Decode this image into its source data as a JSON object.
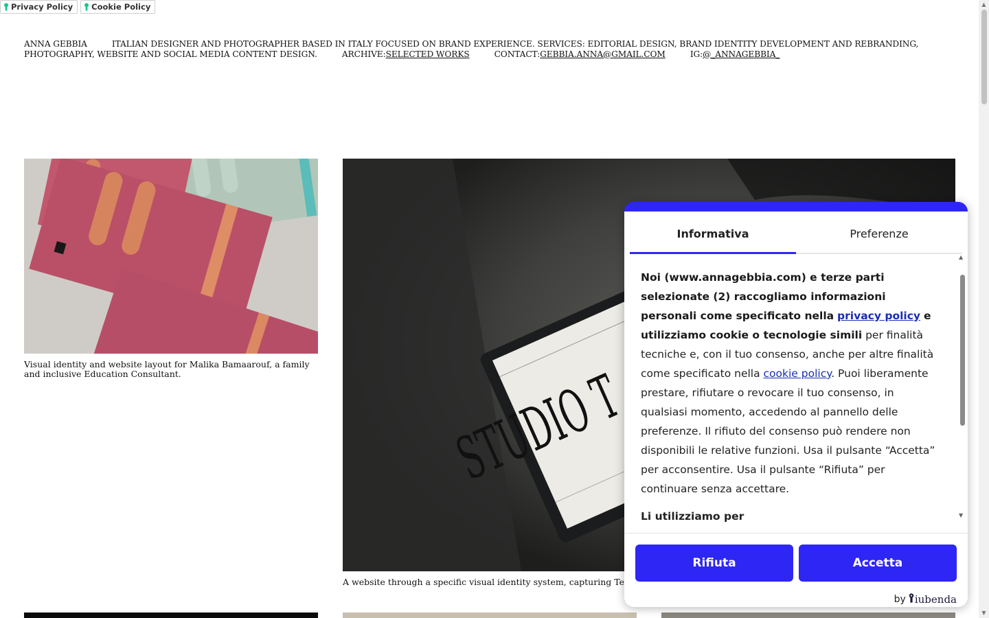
{
  "legal": {
    "privacy_label": "Privacy Policy",
    "cookie_label": "Cookie Policy",
    "accent": "#1cc691"
  },
  "header": {
    "name": "ANNA GEBBIA",
    "bio": "ITALIAN DESIGNER AND PHOTOGRAPHER BASED IN ITALY FOCUSED ON BRAND EXPERIENCE. SERVICES: EDITORIAL DESIGN, BRAND IDENTITY DEVELOPMENT AND REBRANDING, PHOTOGRAPHY, WEBSITE AND SOCIAL MEDIA CONTENT DESIGN.",
    "archive_label": "ARCHIVE:",
    "archive_link": "SELECTED WORKS",
    "contact_label": "CONTACT:",
    "contact_link": "GEBBIA.ANNA@GMAIL.COM",
    "ig_label": "IG:",
    "ig_link": "@_ANNAGEBBIA_"
  },
  "projects": [
    {
      "caption": "Visual identity and website layout for Malika Bamaarouf, a family and inclusive Education Consultant."
    },
    {
      "caption": "A website through a specific visual identity system, capturing Teclas",
      "screen_text": "STUDIO T"
    }
  ],
  "cookie_dialog": {
    "accent": "#2e26f4",
    "tabs": [
      "Informativa",
      "Preferenze"
    ],
    "active_tab": "Informativa",
    "body": {
      "bold_intro": "Noi (www.annagebbia.com) e terze parti selezionate (2) raccogliamo informazioni personali come specificato nella",
      "privacy_link": "privacy policy",
      "bold_mid": "e utilizziamo cookie o tecnologie simili",
      "text_1": "per finalità tecniche e, con il tuo consenso, anche per altre finalità come specificato nella",
      "cookie_link": "cookie policy",
      "text_2": ". Puoi liberamente prestare, rifiutare o revocare il tuo consenso, in qualsiasi momento, accedendo al pannello delle preferenze. Il rifiuto del consenso può rendere non disponibili le relative funzioni. Usa il pulsante “Accetta” per acconsentire. Usa il pulsante “Rifiuta” per continuare senza accettare.",
      "subheading": "Li utilizziamo per"
    },
    "reject_label": "Rifiuta",
    "accept_label": "Accetta",
    "by_label": "by",
    "brand_name": "iubenda"
  }
}
